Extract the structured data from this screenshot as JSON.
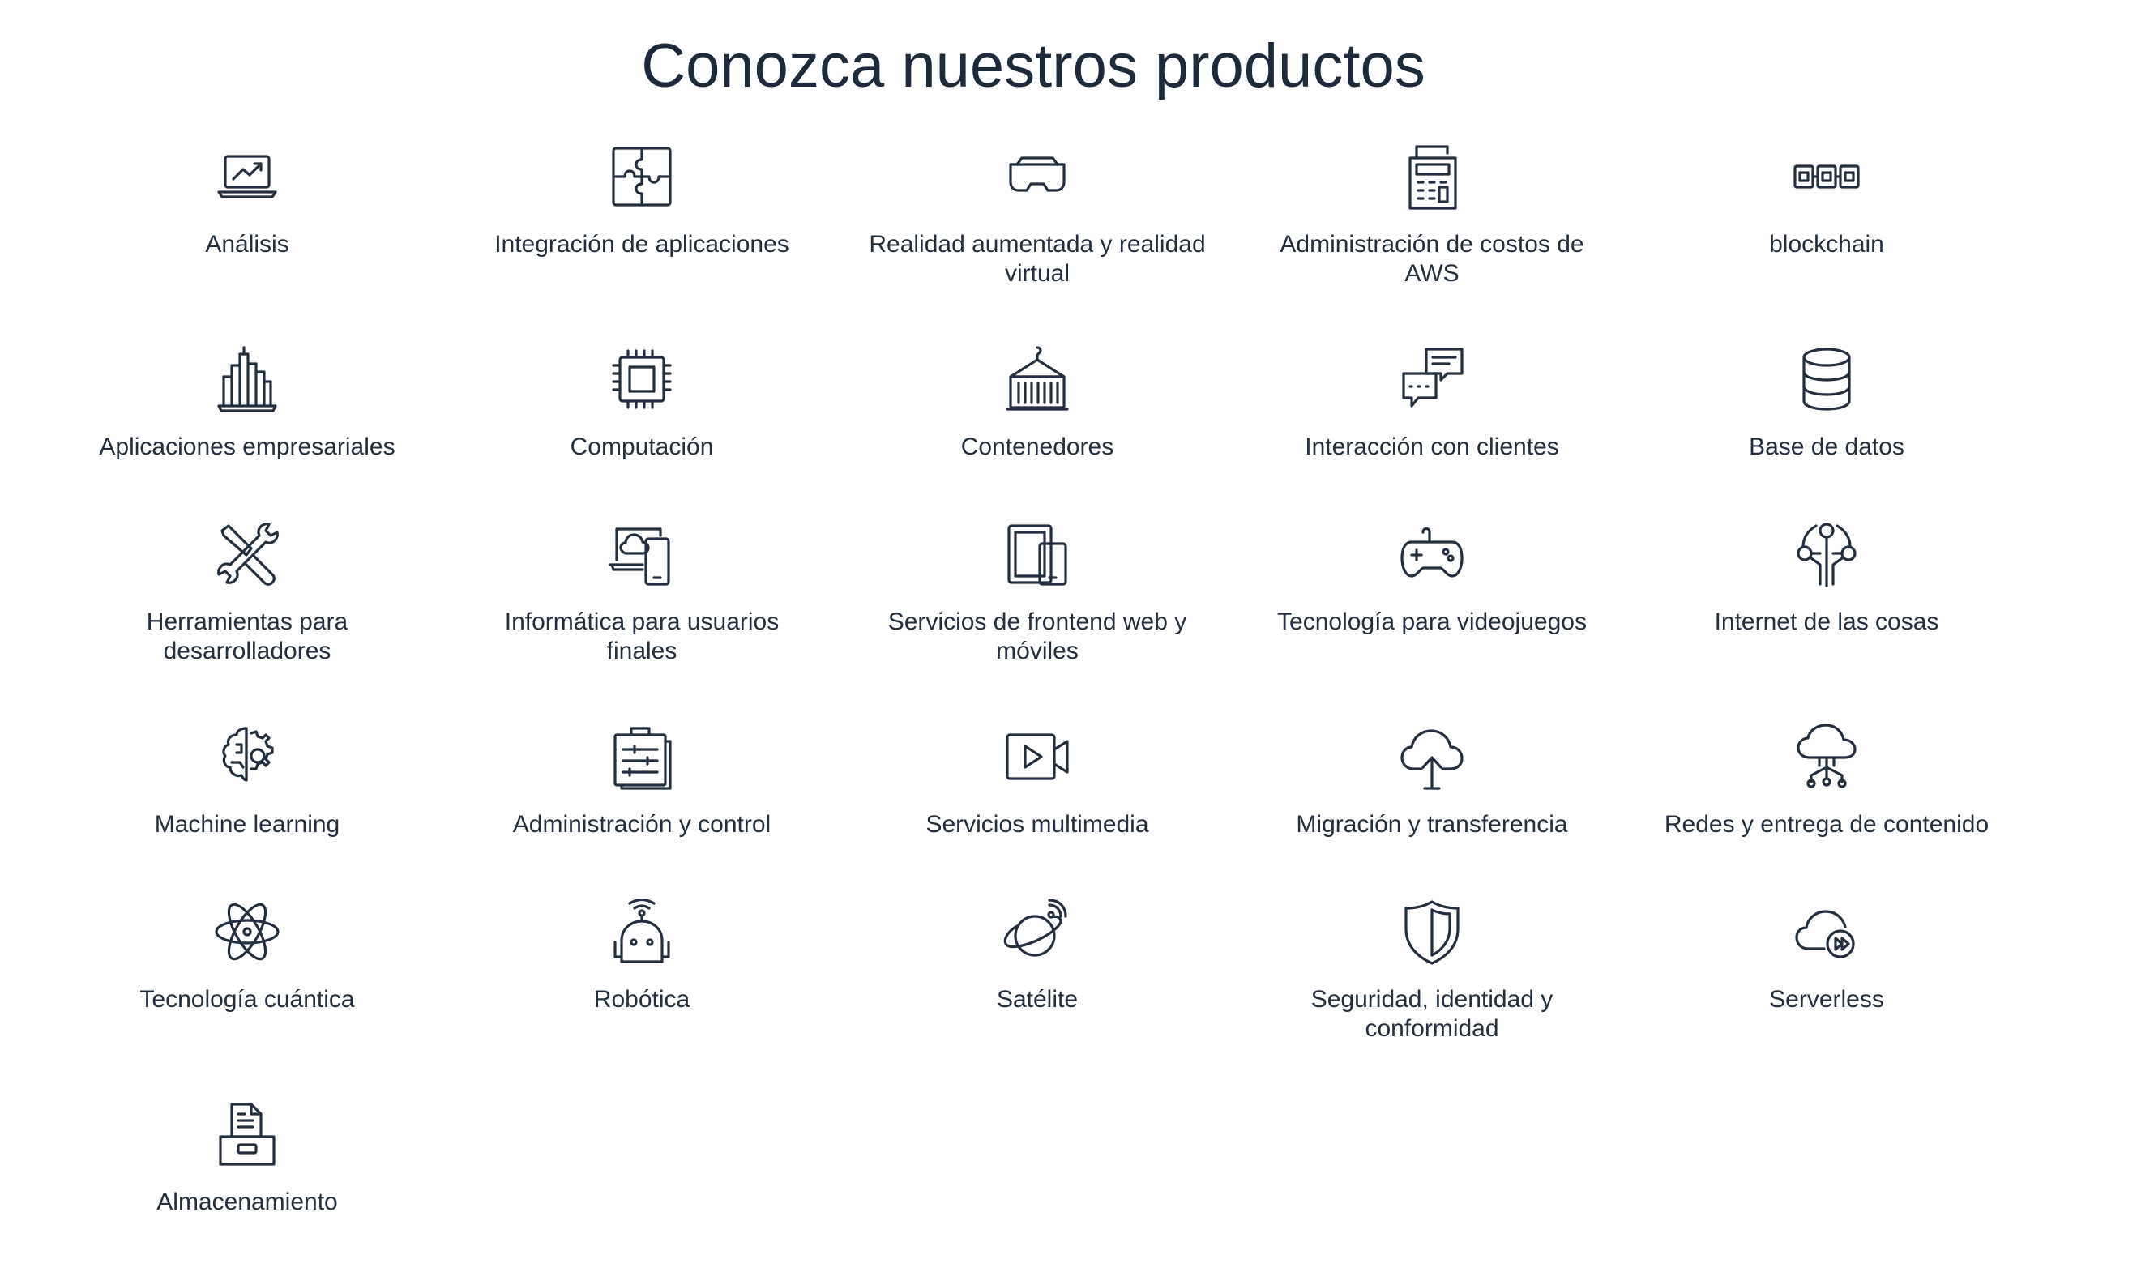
{
  "page": {
    "title": "Conozca nuestros productos"
  },
  "products": [
    {
      "label": "Análisis",
      "icon": "analytics-laptop-icon"
    },
    {
      "label": "Integración de aplicaciones",
      "icon": "puzzle-icon"
    },
    {
      "label": "Realidad aumentada y realidad virtual",
      "icon": "vr-headset-icon"
    },
    {
      "label": "Administración de costos de AWS",
      "icon": "calculator-receipt-icon"
    },
    {
      "label": "blockchain",
      "icon": "chain-blocks-icon"
    },
    {
      "label": "Aplicaciones empresariales",
      "icon": "office-buildings-icon"
    },
    {
      "label": "Computación",
      "icon": "chip-icon"
    },
    {
      "label": "Contenedores",
      "icon": "shipping-container-icon"
    },
    {
      "label": "Interacción con clientes",
      "icon": "chat-bubbles-icon"
    },
    {
      "label": "Base de datos",
      "icon": "database-icon"
    },
    {
      "label": "Herramientas para desarrolladores",
      "icon": "tools-icon"
    },
    {
      "label": "Informática para usuarios finales",
      "icon": "laptop-cloud-phone-icon"
    },
    {
      "label": "Servicios de frontend web y móviles",
      "icon": "tablet-phone-icon"
    },
    {
      "label": "Tecnología para videojuegos",
      "icon": "gamepad-icon"
    },
    {
      "label": "Internet de las cosas",
      "icon": "iot-circuit-icon"
    },
    {
      "label": "Machine learning",
      "icon": "brain-gear-icon"
    },
    {
      "label": "Administración y control",
      "icon": "clipboard-sliders-icon"
    },
    {
      "label": "Servicios multimedia",
      "icon": "video-camera-icon"
    },
    {
      "label": "Migración y transferencia",
      "icon": "cloud-upload-icon"
    },
    {
      "label": "Redes y entrega de contenido",
      "icon": "cloud-network-icon"
    },
    {
      "label": "Tecnología cuántica",
      "icon": "atom-icon"
    },
    {
      "label": "Robótica",
      "icon": "robot-icon"
    },
    {
      "label": "Satélite",
      "icon": "planet-satellite-icon"
    },
    {
      "label": "Seguridad, identidad y conformidad",
      "icon": "shield-icon"
    },
    {
      "label": "Serverless",
      "icon": "cloud-fast-forward-icon"
    },
    {
      "label": "Almacenamiento",
      "icon": "storage-box-icon"
    }
  ]
}
